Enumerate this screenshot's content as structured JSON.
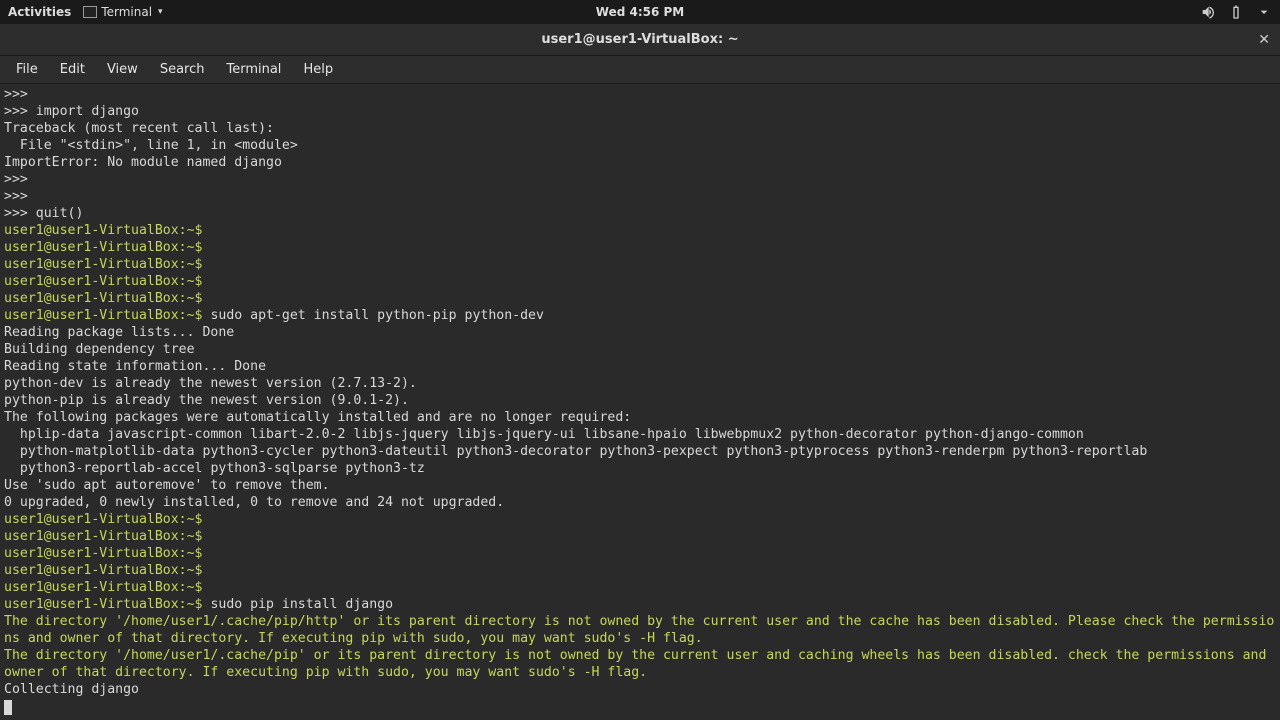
{
  "topbar": {
    "activities": "Activities",
    "terminal_label": "Terminal",
    "clock": "Wed  4:56 PM"
  },
  "window": {
    "title": "user1@user1-VirtualBox: ~"
  },
  "menu": {
    "file": "File",
    "edit": "Edit",
    "view": "View",
    "search": "Search",
    "terminal": "Terminal",
    "help": "Help"
  },
  "lines": {
    "l0": ">>> ",
    "l1": ">>> import django",
    "l2": "Traceback (most recent call last):",
    "l3": "  File \"<stdin>\", line 1, in <module>",
    "l4": "ImportError: No module named django",
    "l5": ">>> ",
    "l6": ">>> ",
    "l7": ">>> quit()",
    "p1": "user1@user1-VirtualBox:~$",
    "p1c": " ",
    "p2": "user1@user1-VirtualBox:~$",
    "p2c": " ",
    "p3": "user1@user1-VirtualBox:~$",
    "p3c": " ",
    "p4": "user1@user1-VirtualBox:~$",
    "p4c": " ",
    "p5": "user1@user1-VirtualBox:~$",
    "p5c": " ",
    "p6": "user1@user1-VirtualBox:~$",
    "p6c": " sudo apt-get install python-pip python-dev",
    "l8": "Reading package lists... Done",
    "l9": "Building dependency tree       ",
    "l10": "Reading state information... Done",
    "l11": "python-dev is already the newest version (2.7.13-2).",
    "l12": "python-pip is already the newest version (9.0.1-2).",
    "l13": "The following packages were automatically installed and are no longer required:",
    "l14": "  hplip-data javascript-common libart-2.0-2 libjs-jquery libjs-jquery-ui libsane-hpaio libwebpmux2 python-decorator python-django-common",
    "l15": "  python-matplotlib-data python3-cycler python3-dateutil python3-decorator python3-pexpect python3-ptyprocess python3-renderpm python3-reportlab",
    "l16": "  python3-reportlab-accel python3-sqlparse python3-tz",
    "l17": "Use 'sudo apt autoremove' to remove them.",
    "l18": "0 upgraded, 0 newly installed, 0 to remove and 24 not upgraded.",
    "p7": "user1@user1-VirtualBox:~$",
    "p7c": " ",
    "p8": "user1@user1-VirtualBox:~$",
    "p8c": " ",
    "p9": "user1@user1-VirtualBox:~$",
    "p9c": " ",
    "p10": "user1@user1-VirtualBox:~$",
    "p10c": " ",
    "p11": "user1@user1-VirtualBox:~$",
    "p11c": " ",
    "p12": "user1@user1-VirtualBox:~$",
    "p12c": " sudo pip install django",
    "w1": "The directory '/home/user1/.cache/pip/http' or its parent directory is not owned by the current user and the cache has been disabled. Please check the permissions and owner of that directory. If executing pip with sudo, you may want sudo's -H flag.",
    "w2": "The directory '/home/user1/.cache/pip' or its parent directory is not owned by the current user and caching wheels has been disabled. check the permissions and owner of that directory. If executing pip with sudo, you may want sudo's -H flag.",
    "l19": "Collecting django"
  }
}
